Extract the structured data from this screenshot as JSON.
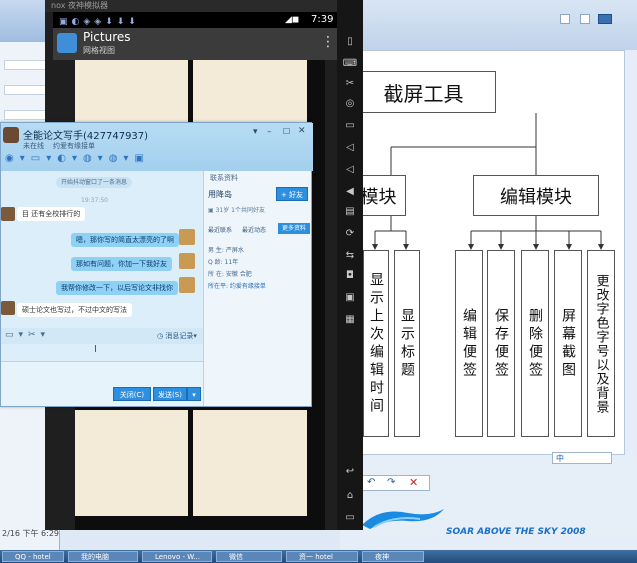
{
  "emulator": {
    "top_title": "nox 夜神模拟器",
    "clock": "7:39",
    "app_title": "Pictures",
    "app_subtitle": "网格视图"
  },
  "qq": {
    "title": "全能论文写手(427747937)",
    "subtitle_a": "未在线",
    "subtitle_b": "约爱有缘接单",
    "notice": "开始抖动窗口了一条消息",
    "time": "19:37:50",
    "messages": [
      {
        "side": "left",
        "text": "目  还有全校排行的"
      },
      {
        "side": "right",
        "text": "嗯，那你写的简直太漂亮的了啊"
      },
      {
        "side": "right",
        "text": "那如有问题，你加一下我好友"
      },
      {
        "side": "right",
        "text": "我帮你修改一下，以后写论文非找你"
      },
      {
        "side": "left",
        "text": "硕士论文也写过，不过中文的写法"
      }
    ],
    "history_label": "消息记录",
    "close_button": "关闭(C)",
    "send_button": "发送(S)",
    "profile_header": "联系资料",
    "profile_name": "用降岛",
    "add_friend": "+ 好友",
    "profile_line": "31岁 1个共同好友",
    "tab_a": "最近联系",
    "tab_b": "最近动态",
    "tab_more": "更多资料",
    "fields": [
      "男 生: 严屏水",
      "Q 龄: 11年",
      "所 在: 安徽 合肥",
      "所在平: 约爱有缘接单"
    ]
  },
  "diagram": {
    "root": "截屏工具",
    "left_module": "模块",
    "right_module": "编辑模块",
    "left_leaves": [
      "显示上次编辑时间",
      "显示标题"
    ],
    "right_leaves": [
      "编辑便签",
      "保存便签",
      "删除便签",
      "屏幕截图",
      "更改字色字号以及背景"
    ],
    "logo": "SOAR ABOVE THE SKY 2008",
    "ime": "中"
  },
  "background": {
    "date": "2/16 下午 6:29"
  },
  "taskbar": {
    "items": [
      "QQ - hotel",
      "我的电脑",
      "Lenovo - W...",
      "微信",
      "资一 hotel",
      "夜神"
    ]
  }
}
